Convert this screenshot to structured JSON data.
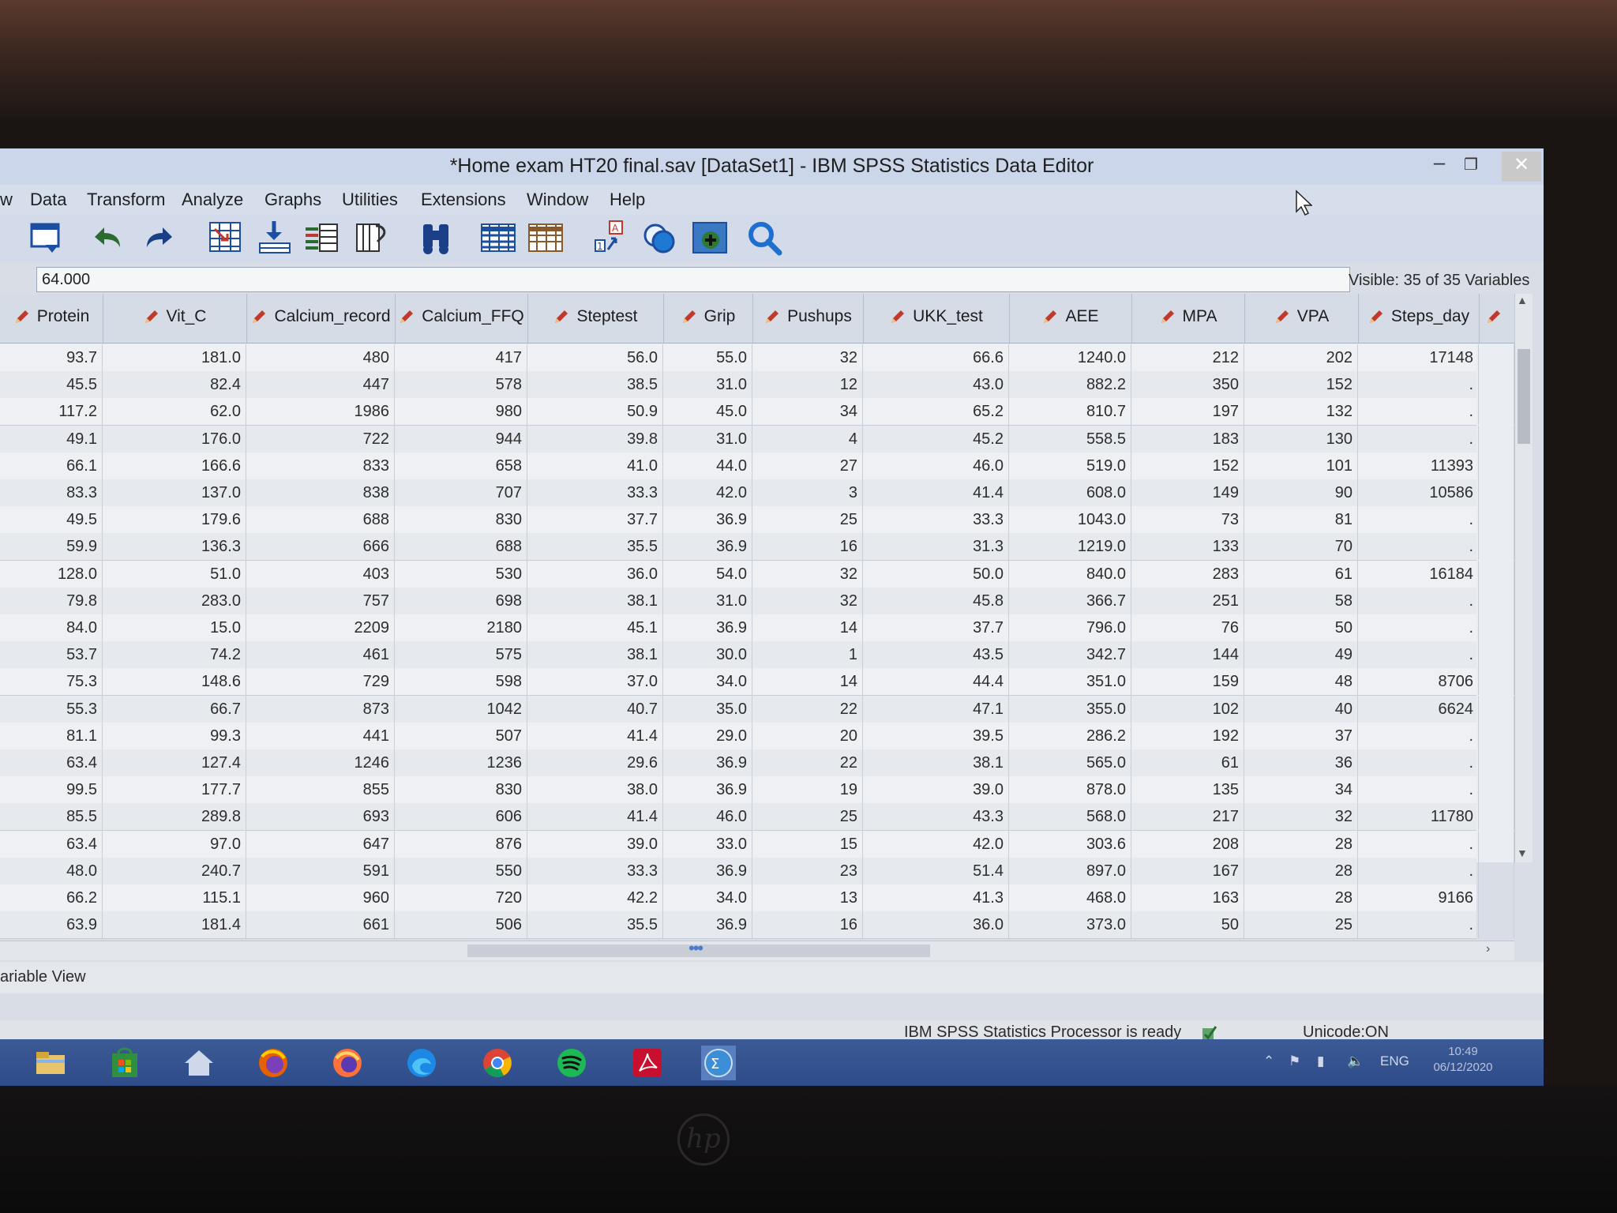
{
  "window": {
    "title": "*Home exam HT20 final.sav [DataSet1] - IBM SPSS Statistics Data Editor",
    "minimize": "–",
    "maximize": "❐",
    "close": "✕"
  },
  "menu": {
    "items": [
      {
        "id": "view",
        "label": "w"
      },
      {
        "id": "data",
        "label": "Data"
      },
      {
        "id": "transform",
        "label": "Transform"
      },
      {
        "id": "analyze",
        "label": "Analyze"
      },
      {
        "id": "graphs",
        "label": "Graphs"
      },
      {
        "id": "utilities",
        "label": "Utilities"
      },
      {
        "id": "extensions",
        "label": "Extensions"
      },
      {
        "id": "window",
        "label": "Window"
      },
      {
        "id": "help",
        "label": "Help"
      }
    ]
  },
  "toolbar": {
    "icons": [
      "dialog-recall-icon",
      "undo-icon",
      "redo-icon",
      "go-to-case-icon",
      "go-to-variable-icon",
      "variables-icon",
      "run-descriptives-icon",
      "find-icon",
      "insert-cases-icon",
      "insert-variable-icon",
      "split-file-icon",
      "select-cases-icon",
      "value-labels-icon",
      "search-icon"
    ]
  },
  "cell_editor": {
    "value": "64.000"
  },
  "visible_variables": "Visible: 35 of 35 Variables",
  "columns": [
    "Protein",
    "Vit_C",
    "Calcium_record",
    "Calcium_FFQ",
    "Steptest",
    "Grip",
    "Pushups",
    "UKK_test",
    "AEE",
    "MPA",
    "VPA",
    "Steps_day",
    ""
  ],
  "rows": [
    [
      "93.7",
      "181.0",
      "480",
      "417",
      "56.0",
      "55.0",
      "32",
      "66.6",
      "1240.0",
      "212",
      "202",
      "17148"
    ],
    [
      "45.5",
      "82.4",
      "447",
      "578",
      "38.5",
      "31.0",
      "12",
      "43.0",
      "882.2",
      "350",
      "152",
      "."
    ],
    [
      "117.2",
      "62.0",
      "1986",
      "980",
      "50.9",
      "45.0",
      "34",
      "65.2",
      "810.7",
      "197",
      "132",
      "."
    ],
    [
      "49.1",
      "176.0",
      "722",
      "944",
      "39.8",
      "31.0",
      "4",
      "45.2",
      "558.5",
      "183",
      "130",
      "."
    ],
    [
      "66.1",
      "166.6",
      "833",
      "658",
      "41.0",
      "44.0",
      "27",
      "46.0",
      "519.0",
      "152",
      "101",
      "11393"
    ],
    [
      "83.3",
      "137.0",
      "838",
      "707",
      "33.3",
      "42.0",
      "3",
      "41.4",
      "608.0",
      "149",
      "90",
      "10586"
    ],
    [
      "49.5",
      "179.6",
      "688",
      "830",
      "37.7",
      "36.9",
      "25",
      "33.3",
      "1043.0",
      "73",
      "81",
      "."
    ],
    [
      "59.9",
      "136.3",
      "666",
      "688",
      "35.5",
      "36.9",
      "16",
      "31.3",
      "1219.0",
      "133",
      "70",
      "."
    ],
    [
      "128.0",
      "51.0",
      "403",
      "530",
      "36.0",
      "54.0",
      "32",
      "50.0",
      "840.0",
      "283",
      "61",
      "16184"
    ],
    [
      "79.8",
      "283.0",
      "757",
      "698",
      "38.1",
      "31.0",
      "32",
      "45.8",
      "366.7",
      "251",
      "58",
      "."
    ],
    [
      "84.0",
      "15.0",
      "2209",
      "2180",
      "45.1",
      "36.9",
      "14",
      "37.7",
      "796.0",
      "76",
      "50",
      "."
    ],
    [
      "53.7",
      "74.2",
      "461",
      "575",
      "38.1",
      "30.0",
      "1",
      "43.5",
      "342.7",
      "144",
      "49",
      "."
    ],
    [
      "75.3",
      "148.6",
      "729",
      "598",
      "37.0",
      "34.0",
      "14",
      "44.4",
      "351.0",
      "159",
      "48",
      "8706"
    ],
    [
      "55.3",
      "66.7",
      "873",
      "1042",
      "40.7",
      "35.0",
      "22",
      "47.1",
      "355.0",
      "102",
      "40",
      "6624"
    ],
    [
      "81.1",
      "99.3",
      "441",
      "507",
      "41.4",
      "29.0",
      "20",
      "39.5",
      "286.2",
      "192",
      "37",
      "."
    ],
    [
      "63.4",
      "127.4",
      "1246",
      "1236",
      "29.6",
      "36.9",
      "22",
      "38.1",
      "565.0",
      "61",
      "36",
      "."
    ],
    [
      "99.5",
      "177.7",
      "855",
      "830",
      "38.0",
      "36.9",
      "19",
      "39.0",
      "878.0",
      "135",
      "34",
      "."
    ],
    [
      "85.5",
      "289.8",
      "693",
      "606",
      "41.4",
      "46.0",
      "25",
      "43.3",
      "568.0",
      "217",
      "32",
      "11780"
    ],
    [
      "63.4",
      "97.0",
      "647",
      "876",
      "39.0",
      "33.0",
      "15",
      "42.0",
      "303.6",
      "208",
      "28",
      "."
    ],
    [
      "48.0",
      "240.7",
      "591",
      "550",
      "33.3",
      "36.9",
      "23",
      "51.4",
      "897.0",
      "167",
      "28",
      "."
    ],
    [
      "66.2",
      "115.1",
      "960",
      "720",
      "42.2",
      "34.0",
      "13",
      "41.3",
      "468.0",
      "163",
      "28",
      "9166"
    ],
    [
      "63.9",
      "181.4",
      "661",
      "506",
      "35.5",
      "36.9",
      "16",
      "36.0",
      "373.0",
      "50",
      "25",
      "."
    ]
  ],
  "view_tab": "ariable View",
  "status": {
    "processor": "IBM SPSS Statistics Processor is ready",
    "unicode": "Unicode:ON"
  },
  "taskbar": {
    "icons": [
      "file-explorer-icon",
      "store-icon",
      "home-icon",
      "firefox-icon",
      "firefox-alt-icon",
      "edge-icon",
      "chrome-icon",
      "spotify-icon",
      "acrobat-icon",
      "spss-icon"
    ],
    "language": "ENG",
    "time": "10:49",
    "date": "06/12/2020"
  },
  "colors": {
    "titlebar": "#ccd6ea",
    "grid_bg": "#eaedf1",
    "taskbar": "#2e4c89",
    "pencil": "#c0392b"
  }
}
